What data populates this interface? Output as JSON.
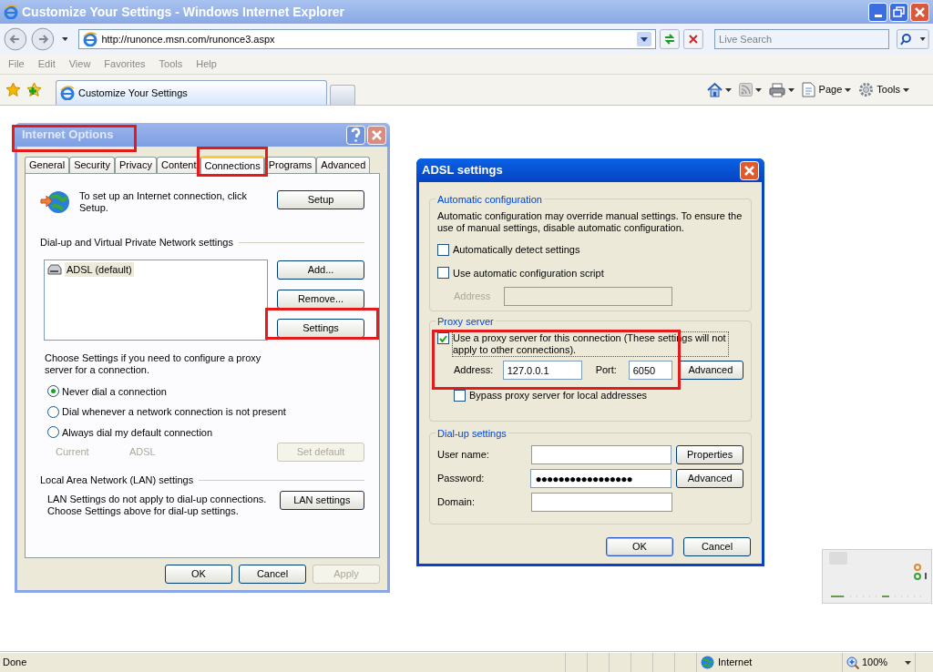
{
  "browser": {
    "title": "Customize Your Settings - Windows Internet Explorer",
    "url": "http://runonce.msn.com/runonce3.aspx",
    "search_placeholder": "Live Search",
    "menu": [
      "File",
      "Edit",
      "View",
      "Favorites",
      "Tools",
      "Help"
    ],
    "tab_title": "Customize Your Settings",
    "command_bar": [
      {
        "kind": "home"
      },
      {
        "kind": "feeds"
      },
      {
        "kind": "print"
      },
      {
        "kind": "page",
        "label": "Page"
      },
      {
        "kind": "tools",
        "label": "Tools"
      }
    ],
    "status_bar": {
      "text": "Done",
      "zone": "Internet",
      "zoom": "100%"
    }
  },
  "internet_options": {
    "title": "Internet Options",
    "tabs": [
      {
        "label": "General",
        "selected": false
      },
      {
        "label": "Security",
        "selected": false
      },
      {
        "label": "Privacy",
        "selected": false
      },
      {
        "label": "Content",
        "selected": false
      },
      {
        "label": "Connections",
        "selected": true
      },
      {
        "label": "Programs",
        "selected": false
      },
      {
        "label": "Advanced",
        "selected": false
      }
    ],
    "setup_text": "To set up an Internet connection, click Setup.",
    "setup_button": "Setup",
    "vpn_heading": "Dial-up and Virtual Private Network settings",
    "connections": [
      {
        "label": "ADSL (default)",
        "selected": true
      }
    ],
    "side_buttons": [
      "Add...",
      "Remove...",
      "Settings"
    ],
    "choose_text": "Choose Settings if you need to configure a proxy server for a connection.",
    "dial_options": [
      {
        "label": "Never dial a connection",
        "selected": true
      },
      {
        "label": "Dial whenever a network connection is not present",
        "selected": false
      },
      {
        "label": "Always dial my default connection",
        "selected": false
      }
    ],
    "current_label": "Current",
    "current_value": "ADSL",
    "set_default": {
      "label": "Set default",
      "disabled": true
    },
    "lan_heading": "Local Area Network (LAN) settings",
    "lan_text": "LAN Settings do not apply to dial-up connections. Choose Settings above for dial-up settings.",
    "lan_button": "LAN settings",
    "footer": [
      {
        "label": "OK",
        "disabled": false
      },
      {
        "label": "Cancel",
        "disabled": false
      },
      {
        "label": "Apply",
        "disabled": true
      }
    ]
  },
  "adsl_settings": {
    "title": "ADSL settings",
    "automatic": {
      "legend": "Automatic configuration",
      "text": "Automatic configuration may override manual settings.  To ensure the use of manual settings, disable automatic configuration.",
      "options": [
        {
          "label": "Automatically detect settings",
          "checked": false
        },
        {
          "label": "Use automatic configuration script",
          "checked": false
        }
      ],
      "address_label": "Address",
      "address_disabled": true
    },
    "proxy": {
      "legend": "Proxy server",
      "use_proxy": {
        "label": "Use a proxy server for this connection (These settings will not apply to other connections).",
        "checked": true
      },
      "address_label": "Address:",
      "address_value": "127.0.0.1",
      "port_label": "Port:",
      "port_value": "6050",
      "advanced_button": "Advanced",
      "bypass": {
        "label": "Bypass proxy server for local addresses",
        "checked": false
      }
    },
    "dialup": {
      "legend": "Dial-up settings",
      "fields": [
        {
          "label": "User name:"
        },
        {
          "label": "Password:",
          "value": "●●●●●●●●●●●●●●●●●"
        },
        {
          "label": "Domain:"
        }
      ],
      "buttons": [
        "Properties",
        "Advanced"
      ]
    },
    "footer": [
      "OK",
      "Cancel"
    ]
  }
}
